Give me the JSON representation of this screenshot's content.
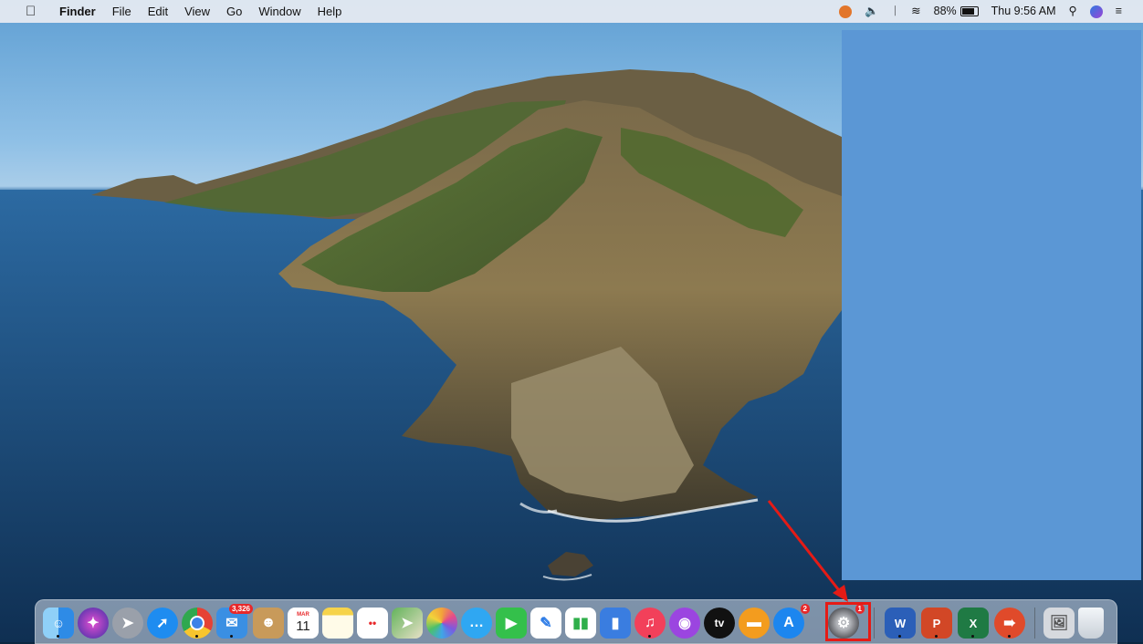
{
  "menubar": {
    "apple_icon": "apple-logo-icon",
    "app_name": "Finder",
    "menus": [
      "File",
      "Edit",
      "View",
      "Go",
      "Window",
      "Help"
    ],
    "status": {
      "battery_percent": "88%",
      "datetime": "Thu 9:56 AM"
    }
  },
  "dock": {
    "items": [
      {
        "name": "finder",
        "icon": "finder-icon",
        "color": "#2e8be6"
      },
      {
        "name": "siri",
        "icon": "siri-icon",
        "color": "#5b3fd1"
      },
      {
        "name": "launchpad",
        "icon": "launchpad-icon",
        "color": "#8a8f99"
      },
      {
        "name": "safari",
        "icon": "safari-icon",
        "color": "#1e8cf0"
      },
      {
        "name": "chrome",
        "icon": "chrome-icon",
        "color": "#e54235"
      },
      {
        "name": "mail",
        "icon": "mail-icon",
        "color": "#3a8fe3",
        "badge": "3,326"
      },
      {
        "name": "contacts",
        "icon": "contacts-icon",
        "color": "#c89a5a"
      },
      {
        "name": "calendar",
        "icon": "calendar-icon",
        "color": "#ffffff",
        "month": "MAR",
        "day": "11"
      },
      {
        "name": "notes",
        "icon": "notes-icon",
        "color": "#f6d34a"
      },
      {
        "name": "reminders",
        "icon": "reminders-icon",
        "color": "#ffffff"
      },
      {
        "name": "maps",
        "icon": "maps-icon",
        "color": "#63b35b"
      },
      {
        "name": "photos",
        "icon": "photos-icon",
        "color": "#f2a33a"
      },
      {
        "name": "messages",
        "icon": "messages-icon",
        "color": "#2fa7f2"
      },
      {
        "name": "facetime",
        "icon": "facetime-icon",
        "color": "#34c04b"
      },
      {
        "name": "freeform",
        "icon": "pencil-icon",
        "color": "#2e7ce6"
      },
      {
        "name": "numbers",
        "icon": "numbers-icon",
        "color": "#2faf4a"
      },
      {
        "name": "keynote",
        "icon": "keynote-icon",
        "color": "#3a7de0"
      },
      {
        "name": "music",
        "icon": "music-icon",
        "color": "#f2405a"
      },
      {
        "name": "podcasts",
        "icon": "podcasts-icon",
        "color": "#9b45e0"
      },
      {
        "name": "apple-tv",
        "icon": "apple-tv-icon",
        "color": "#111111",
        "label": "tv"
      },
      {
        "name": "books",
        "icon": "books-icon",
        "color": "#f39c1e"
      },
      {
        "name": "app-store",
        "icon": "app-store-icon",
        "color": "#1c86ef",
        "badge": "2"
      },
      {
        "name": "system-preferences",
        "icon": "gear-icon",
        "color": "#6d6d72",
        "badge": "1"
      },
      {
        "name": "word",
        "icon": "word-icon",
        "color": "#2b5fb8",
        "label": "W"
      },
      {
        "name": "powerpoint",
        "icon": "powerpoint-icon",
        "color": "#d24726",
        "label": "P"
      },
      {
        "name": "excel",
        "icon": "excel-icon",
        "color": "#1f7a44",
        "label": "X"
      },
      {
        "name": "remote-desktop",
        "icon": "remote-desktop-icon",
        "color": "#e04a2a"
      },
      {
        "name": "downloads",
        "icon": "downloads-stack-icon",
        "color": "#d6d9de"
      },
      {
        "name": "trash",
        "icon": "trash-icon",
        "color": "#e9edf1"
      }
    ]
  }
}
